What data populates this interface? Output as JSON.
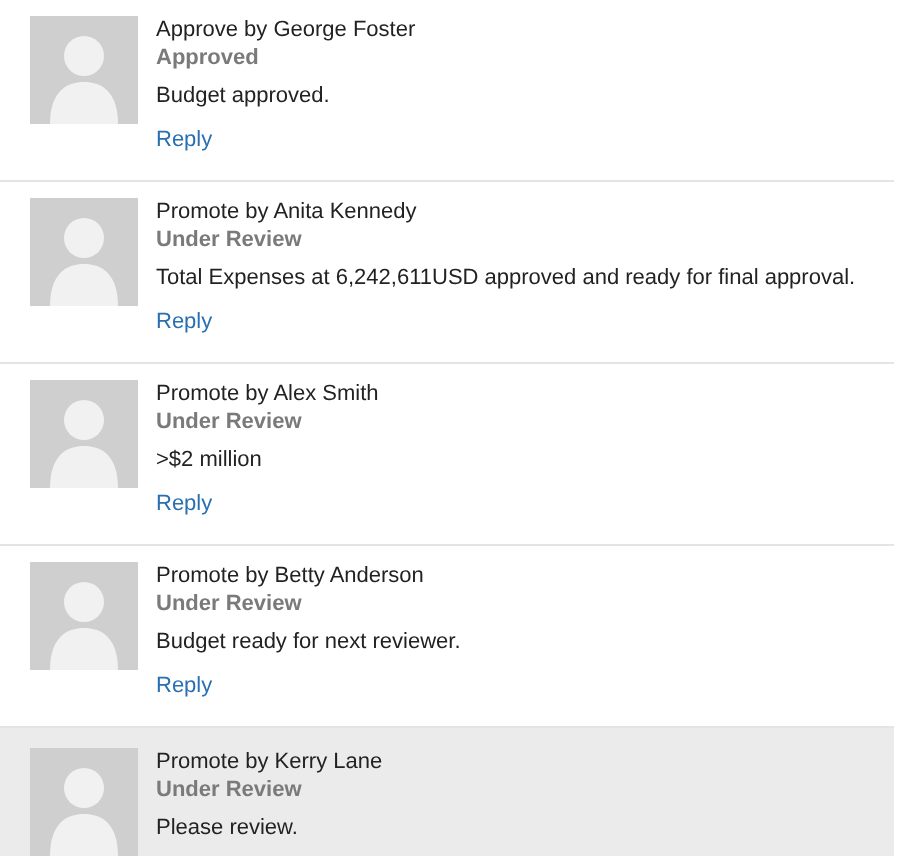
{
  "comments": [
    {
      "title": "Approve by George Foster",
      "status": "Approved",
      "message": "Budget approved.",
      "reply": "Reply",
      "selected": false
    },
    {
      "title": "Promote by Anita Kennedy",
      "status": "Under Review",
      "message": "Total Expenses at 6,242,611USD approved and ready for final approval.",
      "reply": "Reply",
      "selected": false
    },
    {
      "title": "Promote by Alex Smith",
      "status": "Under Review",
      "message": ">$2 million",
      "reply": "Reply",
      "selected": false
    },
    {
      "title": "Promote by Betty Anderson",
      "status": "Under Review",
      "message": "Budget ready for next reviewer.",
      "reply": "Reply",
      "selected": false
    },
    {
      "title": "Promote by Kerry Lane",
      "status": "Under Review",
      "message": "Please review.",
      "selected": true
    }
  ]
}
